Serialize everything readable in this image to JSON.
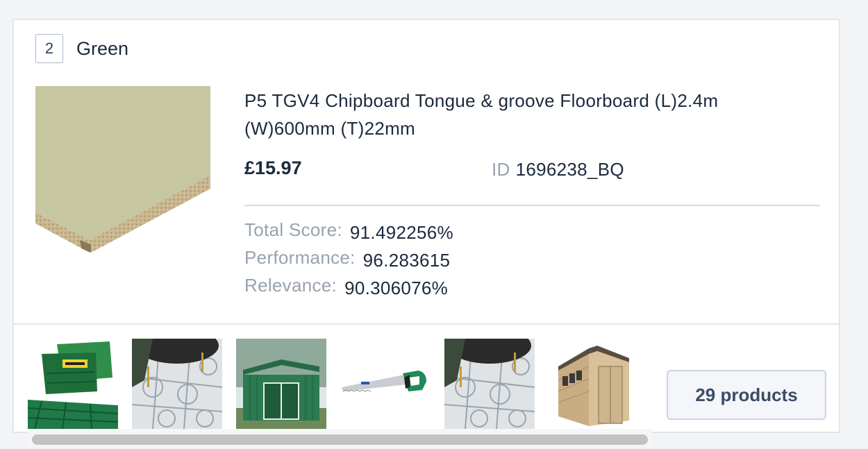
{
  "group": {
    "rank": "2",
    "name": "Green"
  },
  "product": {
    "image_icon": "chipboard-floorboard-image",
    "title": "P5 TGV4 Chipboard Tongue & groove Floorboard (L)2.4m (W)600mm (T)22mm",
    "price": "£15.97",
    "id_label": "ID",
    "id_value": "1696238_BQ"
  },
  "metrics": [
    {
      "label": "Total Score:",
      "value": "91.492256%"
    },
    {
      "label": "Performance:",
      "value": "96.283615"
    },
    {
      "label": "Relevance:",
      "value": "90.306076%"
    }
  ],
  "thumbnails": [
    {
      "icon": "green-grass-tiles-image"
    },
    {
      "icon": "patterned-floor-tiles-image"
    },
    {
      "icon": "green-metal-shed-image"
    },
    {
      "icon": "hand-saw-image"
    },
    {
      "icon": "patterned-floor-tiles-image"
    },
    {
      "icon": "wooden-shed-image"
    }
  ],
  "products_count": "29 products",
  "colors": {
    "text": "#1b2a3e",
    "muted": "#98a2ae",
    "border": "#e1e5ea",
    "badge_border": "#a9b6c8",
    "button_text": "#3d4c66"
  }
}
